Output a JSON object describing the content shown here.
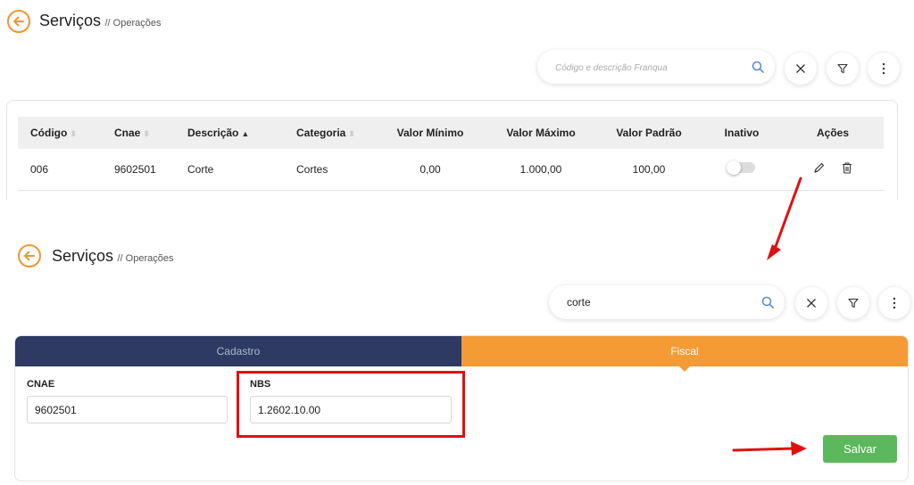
{
  "screen1": {
    "title": "Serviços",
    "subtitle": "// Operações",
    "search": {
      "placeholder": "Código e descrição Franqua",
      "value": ""
    },
    "table": {
      "columns": [
        "Código",
        "Cnae",
        "Descrição",
        "Categoria",
        "Valor Mínimo",
        "Valor Máximo",
        "Valor Padrão",
        "Inativo",
        "Ações"
      ],
      "rows": [
        {
          "codigo": "006",
          "cnae": "9602501",
          "descricao": "Corte",
          "categoria": "Cortes",
          "valor_minimo": "0,00",
          "valor_maximo": "1.000,00",
          "valor_padrao": "100,00",
          "inativo": false
        }
      ]
    }
  },
  "screen2": {
    "title": "Serviços",
    "subtitle": "// Operações",
    "search": {
      "placeholder": "",
      "value": "corte"
    },
    "tabs": [
      {
        "label": "Cadastro",
        "active": false
      },
      {
        "label": "Fiscal",
        "active": true
      }
    ],
    "form": {
      "cnae_label": "CNAE",
      "cnae_value": "9602501",
      "nbs_label": "NBS",
      "nbs_value": "1.2602.10.00"
    },
    "save_label": "Salvar"
  },
  "icons": [
    "back-arrow-icon",
    "search-icon",
    "close-icon",
    "filter-icon",
    "more-vertical-icon",
    "pencil-icon",
    "trash-icon"
  ],
  "colors": {
    "accent_orange": "#f59b35",
    "tab_navy": "#2e3a63",
    "save_green": "#5cb85c",
    "annotation_red": "#e01010"
  }
}
